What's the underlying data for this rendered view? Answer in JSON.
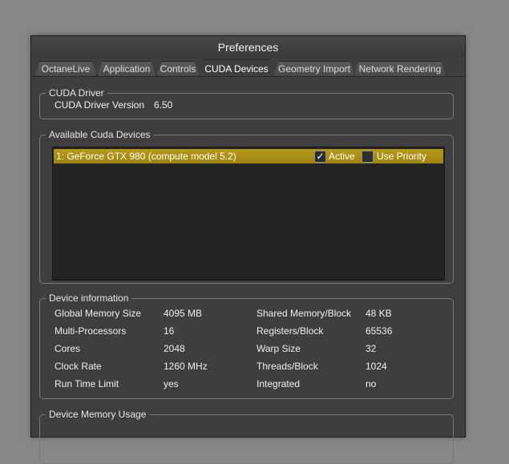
{
  "window": {
    "title": "Preferences"
  },
  "tabs": [
    {
      "label": "OctaneLive",
      "active": false
    },
    {
      "label": "Application",
      "active": false
    },
    {
      "label": "Controls",
      "active": false
    },
    {
      "label": "CUDA Devices",
      "active": true
    },
    {
      "label": "Geometry Import",
      "active": false
    },
    {
      "label": "Network Rendering",
      "active": false
    }
  ],
  "cuda_driver": {
    "legend": "CUDA Driver",
    "version_label": "CUDA Driver Version",
    "version_value": "6.50"
  },
  "devices": {
    "legend": "Available Cuda Devices",
    "items": [
      {
        "name": "1: GeForce GTX 980 (compute model 5.2)",
        "active_label": "Active",
        "active_checked": true,
        "priority_label": "Use Priority",
        "priority_checked": false,
        "check_glyph": "✓"
      }
    ]
  },
  "device_info": {
    "legend": "Device information",
    "left": [
      {
        "label": "Global Memory Size",
        "value": "4095 MB"
      },
      {
        "label": "Multi-Processors",
        "value": "16"
      },
      {
        "label": "Cores",
        "value": "2048"
      },
      {
        "label": "Clock Rate",
        "value": "1260 MHz"
      },
      {
        "label": "Run Time Limit",
        "value": "yes"
      }
    ],
    "right": [
      {
        "label": "Shared Memory/Block",
        "value": "48 KB"
      },
      {
        "label": "Registers/Block",
        "value": "65536"
      },
      {
        "label": "Warp Size",
        "value": "32"
      },
      {
        "label": "Threads/Block",
        "value": "1024"
      },
      {
        "label": "Integrated",
        "value": "no"
      }
    ]
  },
  "memory_usage": {
    "legend": "Device Memory Usage"
  },
  "colors": {
    "selection": "#a88c12",
    "panel": "#3e3e3e",
    "background": "#878787"
  }
}
